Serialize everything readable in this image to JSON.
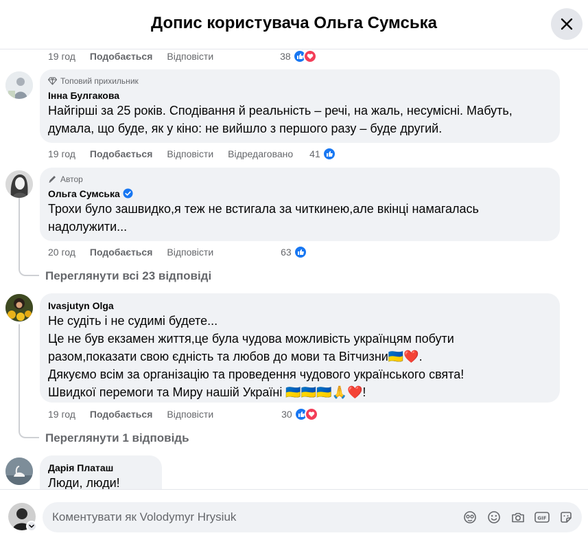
{
  "header": {
    "title": "Допис користувача Ольга Сумська"
  },
  "labels": {
    "like": "Подобається",
    "reply": "Відповісти",
    "edited": "Відредаговано"
  },
  "top_meta": {
    "time": "19 год",
    "count": "38"
  },
  "comments": [
    {
      "badge": "Топовий прихильник",
      "author": "Інна Булгакова",
      "text_lines": [
        "Найгірші за 25 років. Сподівання й реальність – речі, на жаль, несумісні. Мабуть,",
        "думала, що буде, як у кіно: не вийшло з першого разу – буде другий."
      ],
      "time": "19 год",
      "count": "41"
    },
    {
      "badge": "Автор",
      "author": "Ольга Сумська",
      "text_lines": [
        "Трохи було зашвидко,я теж не встигала за читкинею,але вкінці намагалась",
        "надолужити..."
      ],
      "time": "20 год",
      "count": "63",
      "view_replies": "Переглянути всі 23 відповіді"
    },
    {
      "author": "Ivasjutyn Olga",
      "text_lines": [
        "Не судіть і не судимі будете...",
        "Це не був екзамен життя,це була чудова можливість українцям побути",
        "разом,показати свою єдність та любов до мови та Вітчизни🇺🇦❤️.",
        "Дякуємо всім за організацію та проведення чудового українського свята!",
        "Швидкої перемоги та Миру нашій Україні 🇺🇦🇺🇦🇺🇦🙏❤️!"
      ],
      "time": "19 год",
      "count": "30",
      "view_replies": "Переглянути 1 відповідь"
    },
    {
      "author": "Дарія Платаш",
      "text_lines": [
        "Люди, люди!"
      ]
    }
  ],
  "composer": {
    "placeholder": "Коментувати як Volodymyr Hrysiuk"
  },
  "colors": {
    "accent": "#1877f2",
    "love": "#f33e58",
    "bubble": "#f0f2f5",
    "muted": "#65676b"
  },
  "icons": [
    "close-icon",
    "like-reaction-icon",
    "love-reaction-icon",
    "diamond-icon",
    "pencil-icon",
    "verified-badge-icon",
    "avatar-sticker-icon",
    "emoji-icon",
    "camera-icon",
    "gif-icon",
    "sticker-icon",
    "chevron-down-icon"
  ]
}
